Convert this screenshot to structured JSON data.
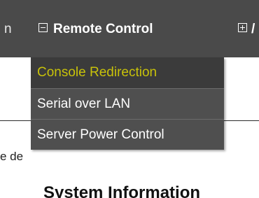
{
  "menubar": {
    "items": [
      {
        "label": "n",
        "partial": true
      },
      {
        "label": "Remote Control",
        "icon": "minus-box-icon",
        "expanded": true
      },
      {
        "label": "/",
        "icon": "plus-box-icon",
        "partial": true
      }
    ]
  },
  "dropdown": {
    "items": [
      {
        "label": "Console Redirection",
        "highlighted": true
      },
      {
        "label": "Serial over LAN"
      },
      {
        "label": "Server Power Control"
      }
    ]
  },
  "content": {
    "side_text": "e de",
    "heading": "System Information"
  },
  "colors": {
    "menubar_bg": "#4a4a4a",
    "dropdown_bg": "#4f4f4f",
    "highlight_text": "#c8c20a"
  }
}
